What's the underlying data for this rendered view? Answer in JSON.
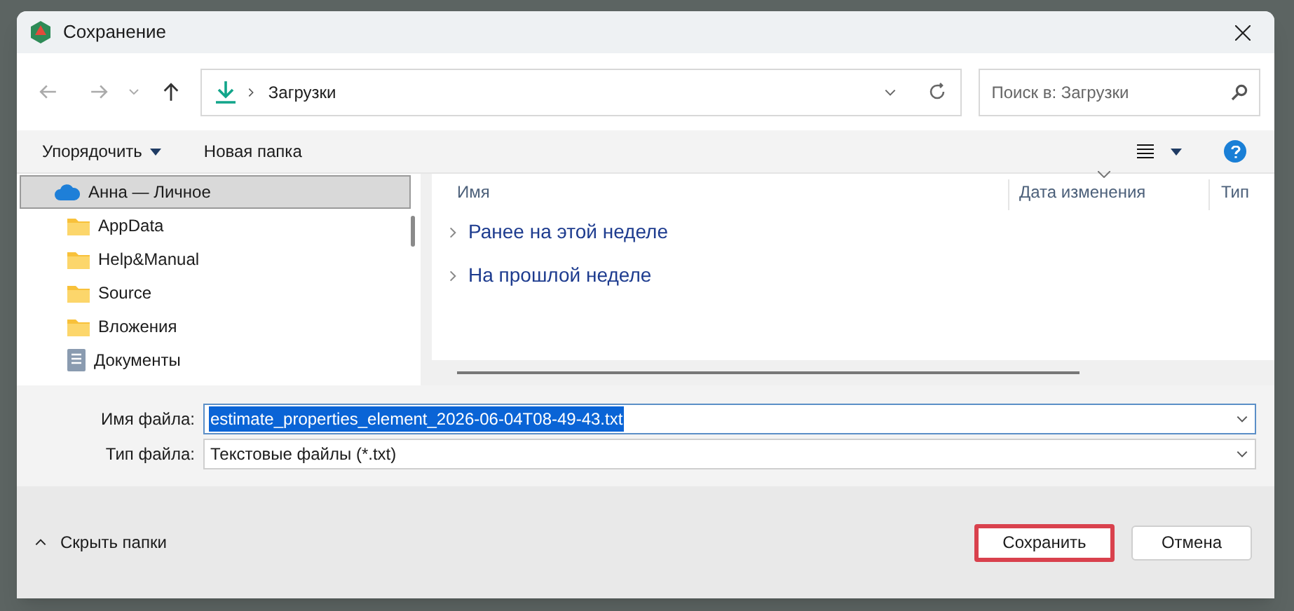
{
  "window": {
    "title": "Сохранение"
  },
  "address": {
    "path": "Загрузки",
    "search_placeholder": "Поиск в: Загрузки"
  },
  "toolbar": {
    "organize": "Упорядочить",
    "new_folder": "Новая папка"
  },
  "sidebar": {
    "items": [
      {
        "label": "Анна — Личное",
        "kind": "cloud",
        "selected": true
      },
      {
        "label": "AppData",
        "kind": "folder",
        "selected": false
      },
      {
        "label": "Help&Manual",
        "kind": "folder",
        "selected": false
      },
      {
        "label": "Source",
        "kind": "folder",
        "selected": false
      },
      {
        "label": "Вложения",
        "kind": "folder",
        "selected": false
      },
      {
        "label": "Документы",
        "kind": "documents",
        "selected": false
      }
    ]
  },
  "table": {
    "columns": [
      "Имя",
      "Дата изменения",
      "Тип"
    ],
    "groups": [
      {
        "label": "Ранее на этой неделе",
        "expanded": false
      },
      {
        "label": "На прошлой неделе",
        "expanded": false
      }
    ]
  },
  "form": {
    "filename_label": "Имя файла:",
    "filename": "estimate_properties_element_2026-06-04T08-49-43.txt",
    "filetype_label": "Тип файла:",
    "filetype": "Текстовые файлы (*.txt)"
  },
  "footer": {
    "hide_folders": "Скрыть папки",
    "save": "Сохранить",
    "cancel": "Отмена"
  }
}
